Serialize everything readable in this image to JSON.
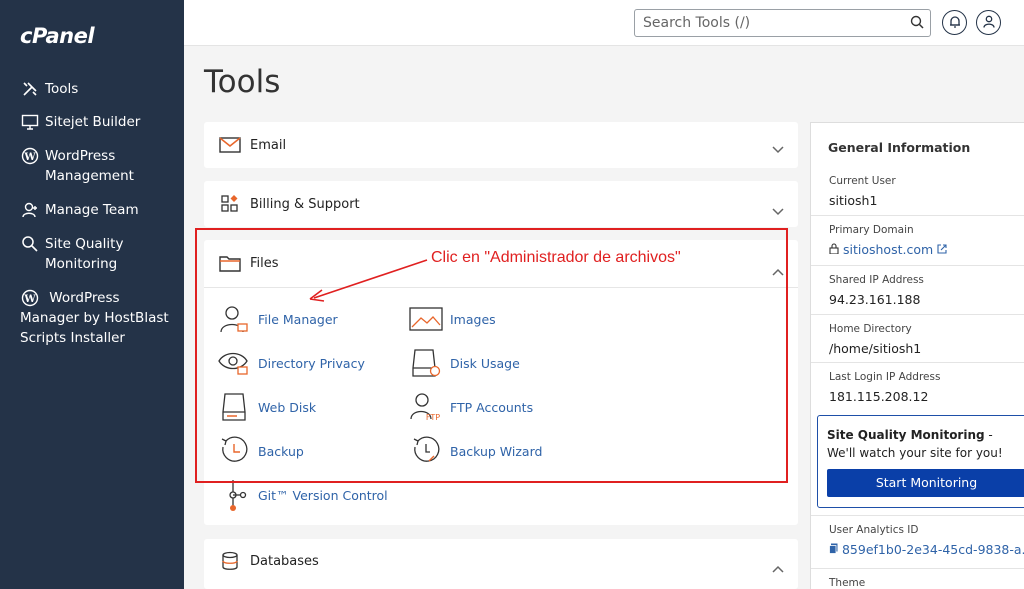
{
  "sidebar": {
    "logo": "cPanel",
    "items": [
      {
        "label": "Tools",
        "icon": "tools-icon"
      },
      {
        "label": "Sitejet Builder",
        "icon": "monitor-icon"
      },
      {
        "label": "WordPress Management",
        "icon": "wordpress-icon"
      },
      {
        "label": "Manage Team",
        "icon": "team-icon"
      },
      {
        "label": "Site Quality Monitoring",
        "icon": "magnifier-icon"
      },
      {
        "label": "WordPress Manager by HostBlast Scripts Installer",
        "icon": "wordpress-icon"
      }
    ]
  },
  "header": {
    "search_placeholder": "Search Tools (/)"
  },
  "page_title": "Tools",
  "sections": {
    "email": {
      "label": "Email"
    },
    "billing": {
      "label": "Billing & Support"
    },
    "files": {
      "label": "Files",
      "tools": [
        {
          "label": "File Manager",
          "icon": "file-manager-icon"
        },
        {
          "label": "Images",
          "icon": "images-icon"
        },
        {
          "label": "Directory Privacy",
          "icon": "directory-privacy-icon"
        },
        {
          "label": "Disk Usage",
          "icon": "disk-usage-icon"
        },
        {
          "label": "Web Disk",
          "icon": "web-disk-icon"
        },
        {
          "label": "FTP Accounts",
          "icon": "ftp-accounts-icon"
        },
        {
          "label": "Backup",
          "icon": "backup-icon"
        },
        {
          "label": "Backup Wizard",
          "icon": "backup-wizard-icon"
        },
        {
          "label": "Git™ Version Control",
          "icon": "git-icon"
        }
      ]
    },
    "databases": {
      "label": "Databases"
    }
  },
  "annotation": "Clic en \"Administrador de archivos\"",
  "general_info": {
    "title": "General Information",
    "current_user_label": "Current User",
    "current_user": "sitiosh1",
    "primary_domain_label": "Primary Domain",
    "primary_domain": "sitioshost.com",
    "shared_ip_label": "Shared IP Address",
    "shared_ip": "94.23.161.188",
    "home_dir_label": "Home Directory",
    "home_dir": "/home/sitiosh1",
    "last_login_label": "Last Login IP Address",
    "last_login_ip": "181.115.208.12",
    "sqm_title": "Site Quality Monitoring",
    "sqm_text": " - We'll watch your site for you!",
    "sqm_button": "Start Monitoring",
    "analytics_label": "User Analytics ID",
    "analytics_id": "859ef1b0-2e34-45cd-9838-a...",
    "theme_label": "Theme"
  },
  "colors": {
    "sidebar": "#243348",
    "accent": "#0a3fa8",
    "link": "#2f63a8",
    "annotation": "#e02020"
  }
}
